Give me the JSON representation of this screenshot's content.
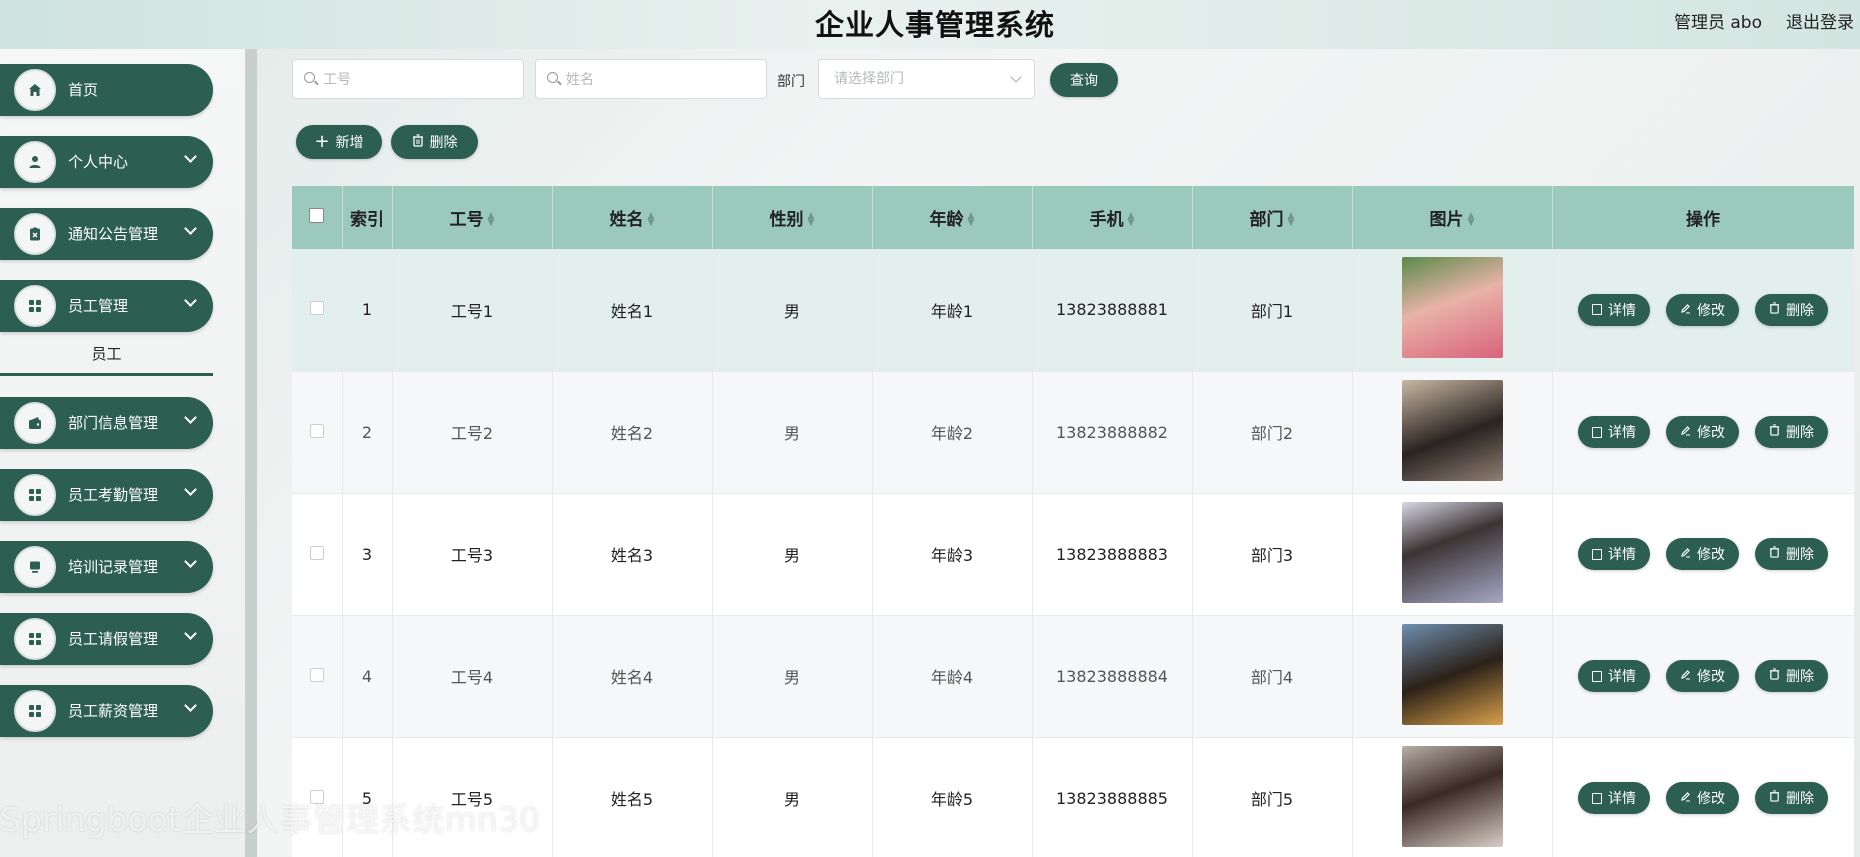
{
  "header": {
    "title": "企业人事管理系统",
    "user_label": "管理员 abo",
    "logout": "退出登录"
  },
  "sidebar": {
    "items": [
      {
        "label": "首页",
        "icon": "home-icon"
      },
      {
        "label": "个人中心",
        "icon": "user-icon"
      },
      {
        "label": "通知公告管理",
        "icon": "clipboard-icon"
      },
      {
        "label": "员工管理",
        "icon": "grid-icon"
      },
      {
        "label": "部门信息管理",
        "icon": "wallet-icon"
      },
      {
        "label": "员工考勤管理",
        "icon": "grid-icon"
      },
      {
        "label": "培训记录管理",
        "icon": "monitor-icon"
      },
      {
        "label": "员工请假管理",
        "icon": "grid-icon"
      },
      {
        "label": "员工薪资管理",
        "icon": "grid-icon"
      }
    ],
    "sub_item": "员工"
  },
  "search": {
    "job_no_placeholder": "工号",
    "name_placeholder": "姓名",
    "dept_label": "部门",
    "dept_placeholder": "请选择部门",
    "query_button": "查询"
  },
  "toolbar": {
    "add_label": "新增",
    "delete_label": "删除"
  },
  "table": {
    "columns": [
      "索引",
      "工号",
      "姓名",
      "性别",
      "年龄",
      "手机",
      "部门",
      "图片",
      "操作"
    ],
    "rows": [
      {
        "index": "1",
        "job_no": "工号1",
        "name": "姓名1",
        "gender": "男",
        "age": "年龄1",
        "phone": "13823888881",
        "dept": "部门1"
      },
      {
        "index": "2",
        "job_no": "工号2",
        "name": "姓名2",
        "gender": "男",
        "age": "年龄2",
        "phone": "13823888882",
        "dept": "部门2"
      },
      {
        "index": "3",
        "job_no": "工号3",
        "name": "姓名3",
        "gender": "男",
        "age": "年龄3",
        "phone": "13823888883",
        "dept": "部门3"
      },
      {
        "index": "4",
        "job_no": "工号4",
        "name": "姓名4",
        "gender": "男",
        "age": "年龄4",
        "phone": "13823888884",
        "dept": "部门4"
      },
      {
        "index": "5",
        "job_no": "工号5",
        "name": "姓名5",
        "gender": "男",
        "age": "年龄5",
        "phone": "13823888885",
        "dept": "部门5"
      }
    ],
    "actions": {
      "detail": "详情",
      "edit": "修改",
      "delete": "删除"
    }
  },
  "watermark": "Springboot企业人事管理系统mn30",
  "colors": {
    "primary": "#2c5f52",
    "header_row": "#9bc9bc",
    "highlight_row": "#e3efec"
  }
}
